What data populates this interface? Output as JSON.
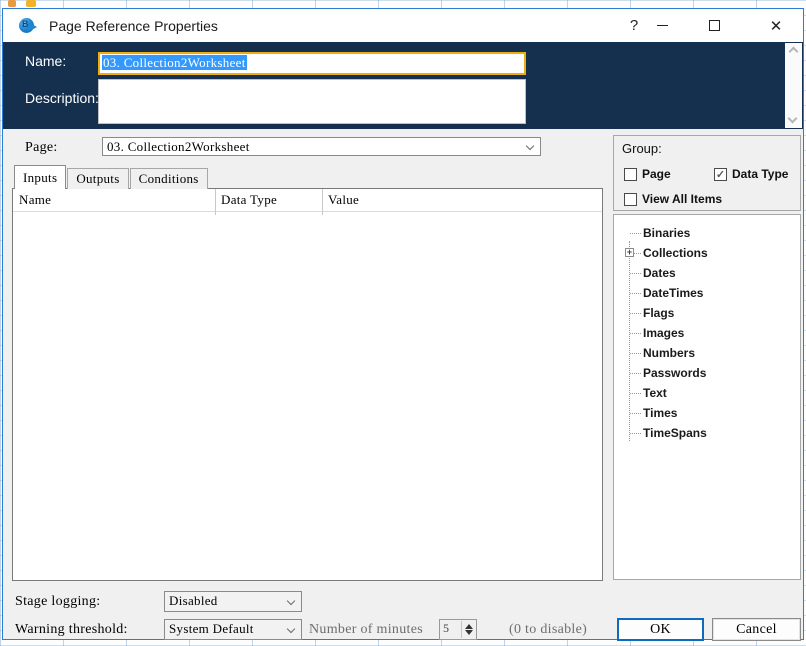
{
  "window": {
    "title": "Page Reference Properties",
    "controls": {
      "help": "?",
      "close": "✕"
    }
  },
  "header": {
    "name_label": "Name:",
    "name_value": "03. Collection2Worksheet",
    "description_label": "Description:",
    "description_value": ""
  },
  "page_row": {
    "label": "Page:",
    "value": "03. Collection2Worksheet"
  },
  "tabs": [
    {
      "label": "Inputs",
      "active": true
    },
    {
      "label": "Outputs",
      "active": false
    },
    {
      "label": "Conditions",
      "active": false
    }
  ],
  "table": {
    "columns": [
      "Name",
      "Data Type",
      "Value"
    ],
    "rows": []
  },
  "group_panel": {
    "title": "Group:",
    "checkboxes": [
      {
        "label": "Page",
        "checked": false,
        "glyph": ""
      },
      {
        "label": "Data Type",
        "checked": true,
        "glyph": "✓"
      },
      {
        "label": "View All Items",
        "checked": false,
        "glyph": ""
      }
    ]
  },
  "tree": {
    "items": [
      {
        "label": "Binaries"
      },
      {
        "label": "Collections",
        "expander": "+"
      },
      {
        "label": "Dates"
      },
      {
        "label": "DateTimes"
      },
      {
        "label": "Flags"
      },
      {
        "label": "Images"
      },
      {
        "label": "Numbers"
      },
      {
        "label": "Passwords"
      },
      {
        "label": "Text"
      },
      {
        "label": "Times"
      },
      {
        "label": "TimeSpans"
      }
    ]
  },
  "footer": {
    "stage_logging_label": "Stage logging:",
    "stage_logging_value": "Disabled",
    "warning_threshold_label": "Warning threshold:",
    "warning_threshold_value": "System Default",
    "minutes_label": "Number of minutes",
    "minutes_value": "5",
    "disable_hint": "(0 to disable)",
    "ok_label": "OK",
    "cancel_label": "Cancel"
  },
  "colors": {
    "navy_band": "#14304e",
    "dialog_border": "#2b7cd6",
    "name_highlight_border": "#eead10",
    "text_selection": "#3399ff",
    "ok_border": "#0f6cbd"
  }
}
